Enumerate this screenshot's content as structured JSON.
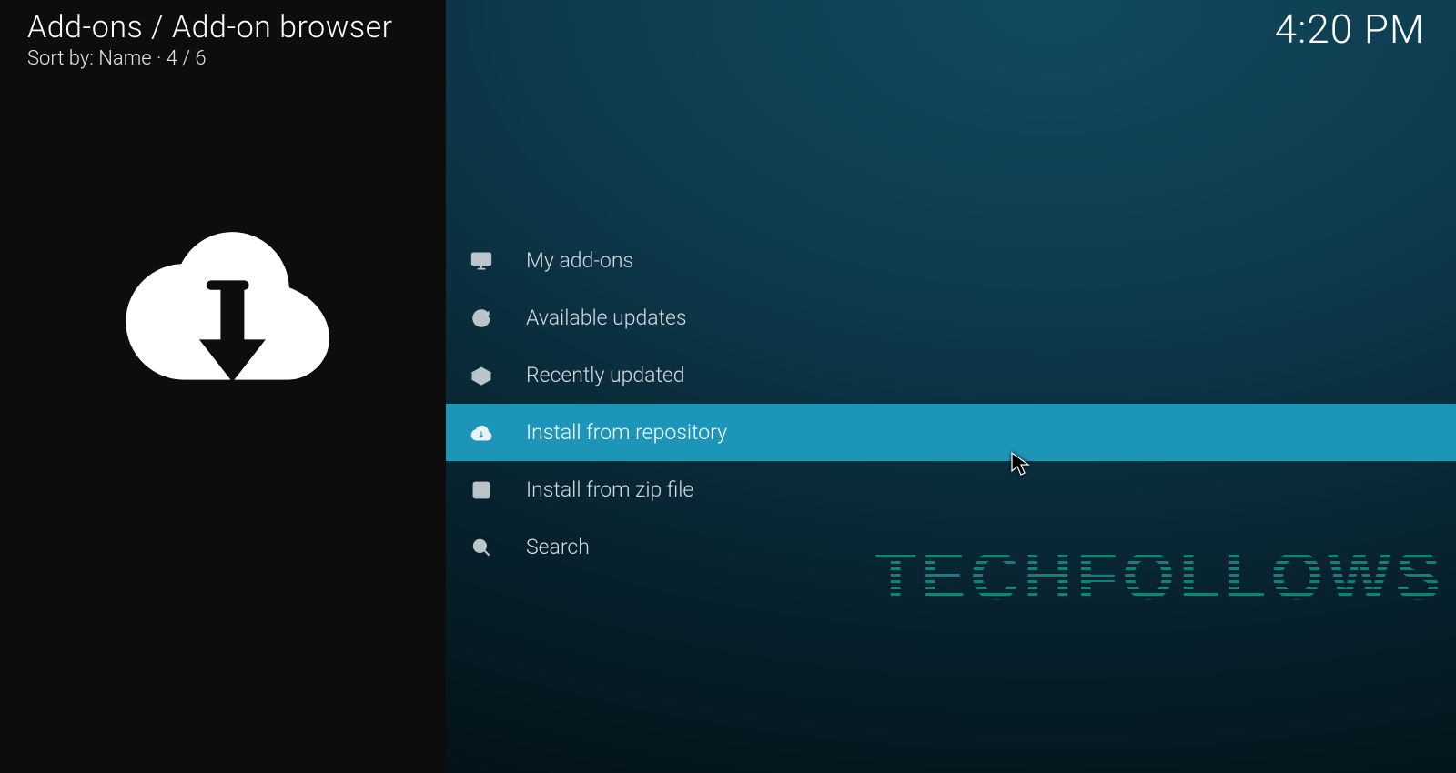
{
  "breadcrumb": "Add-ons / Add-on browser",
  "sort_line": "Sort by: Name   ·  4 / 6",
  "clock": "4:20 PM",
  "menu": [
    {
      "label": "My add-ons",
      "icon": "monitor-icon"
    },
    {
      "label": "Available updates",
      "icon": "refresh-icon"
    },
    {
      "label": "Recently updated",
      "icon": "open-box-icon"
    },
    {
      "label": "Install from repository",
      "icon": "cloud-download-icon"
    },
    {
      "label": "Install from zip file",
      "icon": "zip-file-icon"
    },
    {
      "label": "Search",
      "icon": "search-icon"
    }
  ],
  "selected_index": 3,
  "watermark": "TECHFOLLOWS"
}
